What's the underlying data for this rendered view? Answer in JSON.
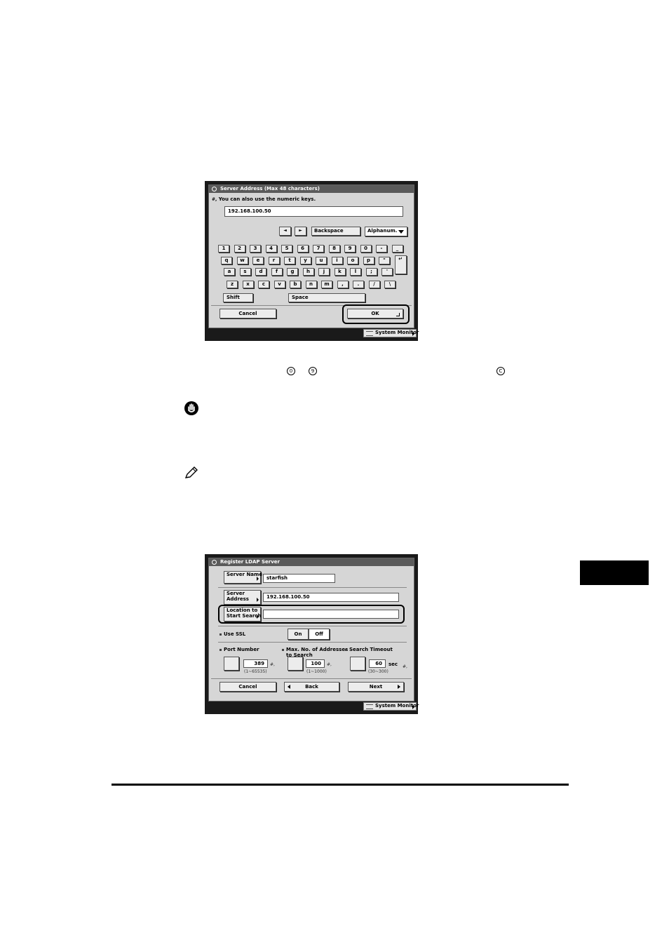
{
  "screen1": {
    "title": "Server Address (Max 48 characters)",
    "hint": "You can also use the numeric keys.",
    "input_value": "192.168.100.50",
    "left_arrow": "◄",
    "right_arrow": "►",
    "backspace": "Backspace",
    "mode": "Alphanum.",
    "row1": [
      "1",
      "2",
      "3",
      "4",
      "5",
      "6",
      "7",
      "8",
      "9",
      "0",
      "-",
      "_"
    ],
    "row2": [
      "q",
      "w",
      "e",
      "r",
      "t",
      "y",
      "u",
      "i",
      "o",
      "p",
      "\"",
      "↵"
    ],
    "row3": [
      "a",
      "s",
      "d",
      "f",
      "g",
      "h",
      "j",
      "k",
      "l",
      ";",
      "'"
    ],
    "row4": [
      "z",
      "x",
      "c",
      "v",
      "b",
      "n",
      "m",
      ",",
      ".",
      "/",
      "\\"
    ],
    "shift": "Shift",
    "space": "Space",
    "cancel": "Cancel",
    "ok": "OK",
    "system_monitor": "System Monitor"
  },
  "keys_line": {
    "k1": "0",
    "k2": "9",
    "k3": "C"
  },
  "screen2": {
    "title": "Register LDAP Server",
    "server_name_btn": "Server Name",
    "server_name_value": "starfish",
    "server_address_btn_1": "Server",
    "server_address_btn_2": "Address",
    "server_address_value": "192.168.100.50",
    "location_btn_1": "Location to",
    "location_btn_2": "Start Search",
    "location_value": "",
    "use_ssl": "Use SSL",
    "on": "On",
    "off": "Off",
    "port_label": "Port Number",
    "port_value": "389",
    "port_range": "(1~65535)",
    "max_label_1": "Max. No. of Addresses",
    "max_label_2": "to Search",
    "max_value": "100",
    "max_range": "(1~1000)",
    "timeout_label": "Search Timeout",
    "timeout_value": "60",
    "timeout_unit": "sec",
    "timeout_range": "(30~300)",
    "cancel": "Cancel",
    "back": "Back",
    "next": "Next",
    "system_monitor": "System Monitor"
  }
}
